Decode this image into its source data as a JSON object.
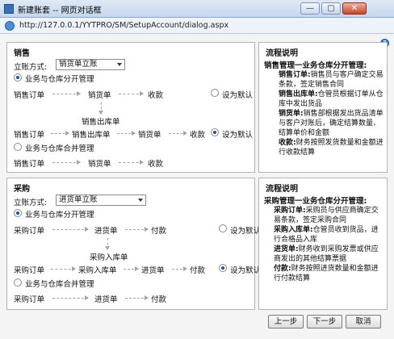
{
  "window": {
    "title": "新建账套 -- 网页对话框",
    "close_label": "✕",
    "min_label": "—",
    "max_label": "▢"
  },
  "address": {
    "url": "http://127.0.0.1/YYTPRO/SM/SetupAccount/dialog.aspx"
  },
  "sales": {
    "title": "销售",
    "mode_label": "立账方式:",
    "mode_value": "销货单立账",
    "opt_separate": "业务与仓库分开管理",
    "opt_merge": "业务与仓库合并管理",
    "row1": [
      "销售订单",
      "销货单",
      "收款"
    ],
    "set_default": "设为默认",
    "mid_node": "销售出库单",
    "row2": [
      "销售订单",
      "销售出库单",
      "销货单",
      "收款"
    ],
    "set_default2": "设为默认",
    "row3": [
      "销售订单",
      "销货单",
      "收款"
    ]
  },
  "sales_desc": {
    "title": "流程说明",
    "heading": "销售管理一业务仓库分开管理:",
    "items": [
      {
        "k": "销售订单:",
        "v": "销售员与客户确定交易条款，签定销售合同"
      },
      {
        "k": "销售出库单:",
        "v": "仓管员根据订单从仓库中发出货品"
      },
      {
        "k": "销货单:",
        "v": "销售部根据发出货品清单与客户对账后，确定结算数量、结算单价和金额"
      },
      {
        "k": "收款:",
        "v": "财务按照发货数量和金额进行收款结算"
      }
    ]
  },
  "purchase": {
    "title": "采购",
    "mode_label": "立账方式:",
    "mode_value": "进货单立账",
    "opt_separate": "业务与仓库分开管理",
    "opt_merge": "业务与仓库合并管理",
    "row1": [
      "采购订单",
      "进货单",
      "付款"
    ],
    "set_default": "设为默认",
    "mid_node": "采购入库单",
    "row2": [
      "采购订单",
      "采购入库单",
      "进货单",
      "付款"
    ],
    "set_default2": "设为默认",
    "row3": [
      "采购订单",
      "进货单",
      "付款"
    ]
  },
  "purchase_desc": {
    "title": "流程说明",
    "heading": "采购管理一业务仓库分开管理:",
    "items": [
      {
        "k": "采购订单:",
        "v": "采购员与供应商确定交易条款，签定采购合同"
      },
      {
        "k": "采购入库单:",
        "v": "仓管员收到货品，进行合格品入库"
      },
      {
        "k": "进货单:",
        "v": "财务收到采购发票或供应商发出的其他结算票据"
      },
      {
        "k": "付款:",
        "v": "财务按照进货数量和金额进行付款结算"
      }
    ]
  },
  "buttons": {
    "prev": "上一步",
    "next": "下一步",
    "cancel": "取消"
  }
}
